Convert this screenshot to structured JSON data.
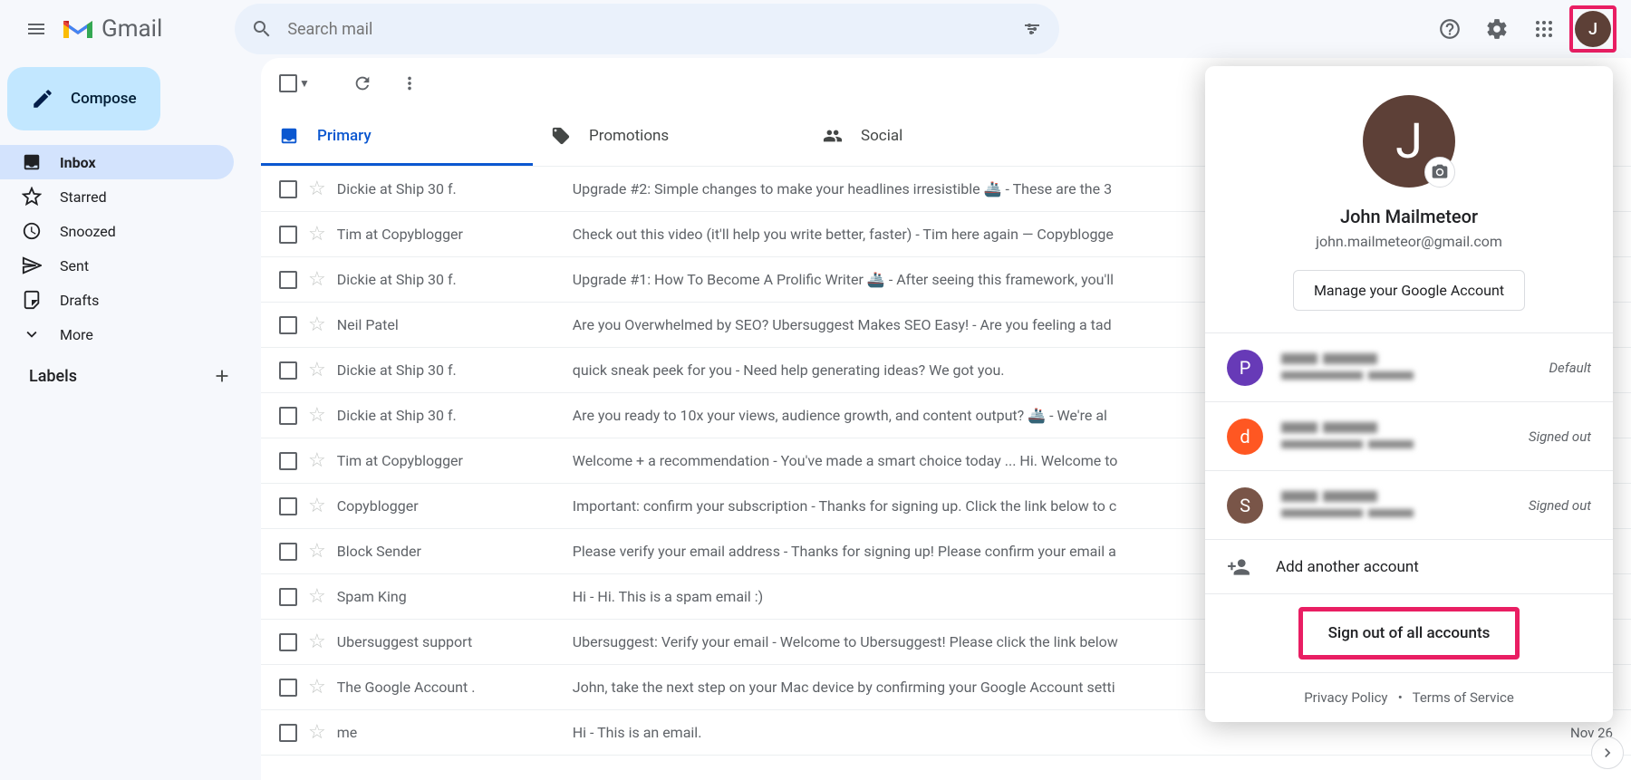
{
  "header": {
    "app_name": "Gmail",
    "search_placeholder": "Search mail",
    "avatar_letter": "J"
  },
  "sidebar": {
    "compose": "Compose",
    "items": [
      {
        "label": "Inbox"
      },
      {
        "label": "Starred"
      },
      {
        "label": "Snoozed"
      },
      {
        "label": "Sent"
      },
      {
        "label": "Drafts"
      },
      {
        "label": "More"
      }
    ],
    "labels_heading": "Labels"
  },
  "tabs": [
    {
      "label": "Primary"
    },
    {
      "label": "Promotions"
    },
    {
      "label": "Social"
    }
  ],
  "emails": [
    {
      "sender": "Dickie at Ship 30 f.",
      "subject": "Upgrade #2: Simple changes to make your headlines irresistible 🚢",
      "snippet": " - These are the 3",
      "date": ""
    },
    {
      "sender": "Tim at Copyblogger",
      "subject": "Check out this video (it'll help you write better, faster)",
      "snippet": " - Tim here again — Copyblogge",
      "date": ""
    },
    {
      "sender": "Dickie at Ship 30 f.",
      "subject": "Upgrade #1: How To Become A Prolific Writer 🚢",
      "snippet": " - After seeing this framework, you'll",
      "date": ""
    },
    {
      "sender": "Neil Patel",
      "subject": "Are you Overwhelmed by SEO? Ubersuggest Makes SEO Easy!",
      "snippet": " - Are you feeling a tad",
      "date": ""
    },
    {
      "sender": "Dickie at Ship 30 f.",
      "subject": "quick sneak peek for you",
      "snippet": " - Need help generating ideas? We got you.",
      "date": ""
    },
    {
      "sender": "Dickie at Ship 30 f.",
      "subject": "Are you ready to 10x your views, audience growth, and content output? 🚢",
      "snippet": " - We're al",
      "date": ""
    },
    {
      "sender": "Tim at Copyblogger",
      "subject": "Welcome + a recommendation",
      "snippet": " - You've made a smart choice today ... Hi. Welcome to",
      "date": ""
    },
    {
      "sender": "Copyblogger",
      "subject": "Important: confirm your subscription",
      "snippet": " - Thanks for signing up. Click the link below to c",
      "date": ""
    },
    {
      "sender": "Block Sender",
      "subject": "Please verify your email address",
      "snippet": " - Thanks for signing up! Please confirm your email a",
      "date": ""
    },
    {
      "sender": "Spam King",
      "subject": "Hi",
      "snippet": " - Hi. This is a spam email :)",
      "date": ""
    },
    {
      "sender": "Ubersuggest support",
      "subject": "Ubersuggest: Verify your email",
      "snippet": " - Welcome to Ubersuggest! Please click the link below",
      "date": ""
    },
    {
      "sender": "The Google Account .",
      "subject": "John, take the next step on your Mac device by confirming your Google Account setti",
      "snippet": "",
      "date": ""
    },
    {
      "sender": "me",
      "subject": "Hi",
      "snippet": " - This is an email.",
      "date": "Nov 26"
    }
  ],
  "account": {
    "avatar_letter": "J",
    "name": "John Mailmeteor",
    "email": "john.mailmeteor@gmail.com",
    "manage_label": "Manage your Google Account",
    "accounts": [
      {
        "letter": "P",
        "color": "#673ab7",
        "status": "Default"
      },
      {
        "letter": "d",
        "color": "#ff5722",
        "status": "Signed out"
      },
      {
        "letter": "S",
        "color": "#795548",
        "status": "Signed out"
      }
    ],
    "add_label": "Add another account",
    "signout_label": "Sign out of all accounts",
    "privacy": "Privacy Policy",
    "terms": "Terms of Service"
  }
}
